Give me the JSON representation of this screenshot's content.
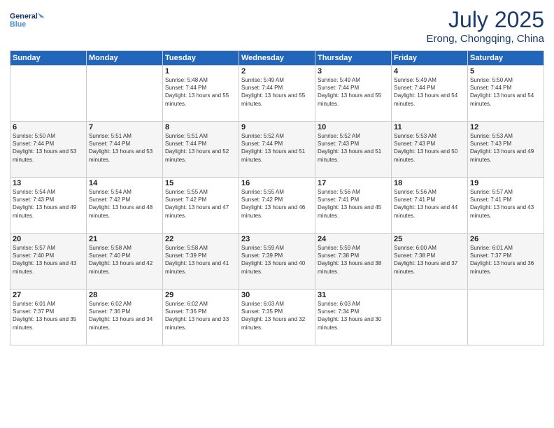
{
  "header": {
    "logo_line1": "General",
    "logo_line2": "Blue",
    "title": "July 2025",
    "subtitle": "Erong, Chongqing, China"
  },
  "weekdays": [
    "Sunday",
    "Monday",
    "Tuesday",
    "Wednesday",
    "Thursday",
    "Friday",
    "Saturday"
  ],
  "weeks": [
    [
      {
        "day": "",
        "sunrise": "",
        "sunset": "",
        "daylight": ""
      },
      {
        "day": "",
        "sunrise": "",
        "sunset": "",
        "daylight": ""
      },
      {
        "day": "1",
        "sunrise": "Sunrise: 5:48 AM",
        "sunset": "Sunset: 7:44 PM",
        "daylight": "Daylight: 13 hours and 55 minutes."
      },
      {
        "day": "2",
        "sunrise": "Sunrise: 5:49 AM",
        "sunset": "Sunset: 7:44 PM",
        "daylight": "Daylight: 13 hours and 55 minutes."
      },
      {
        "day": "3",
        "sunrise": "Sunrise: 5:49 AM",
        "sunset": "Sunset: 7:44 PM",
        "daylight": "Daylight: 13 hours and 55 minutes."
      },
      {
        "day": "4",
        "sunrise": "Sunrise: 5:49 AM",
        "sunset": "Sunset: 7:44 PM",
        "daylight": "Daylight: 13 hours and 54 minutes."
      },
      {
        "day": "5",
        "sunrise": "Sunrise: 5:50 AM",
        "sunset": "Sunset: 7:44 PM",
        "daylight": "Daylight: 13 hours and 54 minutes."
      }
    ],
    [
      {
        "day": "6",
        "sunrise": "Sunrise: 5:50 AM",
        "sunset": "Sunset: 7:44 PM",
        "daylight": "Daylight: 13 hours and 53 minutes."
      },
      {
        "day": "7",
        "sunrise": "Sunrise: 5:51 AM",
        "sunset": "Sunset: 7:44 PM",
        "daylight": "Daylight: 13 hours and 53 minutes."
      },
      {
        "day": "8",
        "sunrise": "Sunrise: 5:51 AM",
        "sunset": "Sunset: 7:44 PM",
        "daylight": "Daylight: 13 hours and 52 minutes."
      },
      {
        "day": "9",
        "sunrise": "Sunrise: 5:52 AM",
        "sunset": "Sunset: 7:44 PM",
        "daylight": "Daylight: 13 hours and 51 minutes."
      },
      {
        "day": "10",
        "sunrise": "Sunrise: 5:52 AM",
        "sunset": "Sunset: 7:43 PM",
        "daylight": "Daylight: 13 hours and 51 minutes."
      },
      {
        "day": "11",
        "sunrise": "Sunrise: 5:53 AM",
        "sunset": "Sunset: 7:43 PM",
        "daylight": "Daylight: 13 hours and 50 minutes."
      },
      {
        "day": "12",
        "sunrise": "Sunrise: 5:53 AM",
        "sunset": "Sunset: 7:43 PM",
        "daylight": "Daylight: 13 hours and 49 minutes."
      }
    ],
    [
      {
        "day": "13",
        "sunrise": "Sunrise: 5:54 AM",
        "sunset": "Sunset: 7:43 PM",
        "daylight": "Daylight: 13 hours and 49 minutes."
      },
      {
        "day": "14",
        "sunrise": "Sunrise: 5:54 AM",
        "sunset": "Sunset: 7:42 PM",
        "daylight": "Daylight: 13 hours and 48 minutes."
      },
      {
        "day": "15",
        "sunrise": "Sunrise: 5:55 AM",
        "sunset": "Sunset: 7:42 PM",
        "daylight": "Daylight: 13 hours and 47 minutes."
      },
      {
        "day": "16",
        "sunrise": "Sunrise: 5:55 AM",
        "sunset": "Sunset: 7:42 PM",
        "daylight": "Daylight: 13 hours and 46 minutes."
      },
      {
        "day": "17",
        "sunrise": "Sunrise: 5:56 AM",
        "sunset": "Sunset: 7:41 PM",
        "daylight": "Daylight: 13 hours and 45 minutes."
      },
      {
        "day": "18",
        "sunrise": "Sunrise: 5:56 AM",
        "sunset": "Sunset: 7:41 PM",
        "daylight": "Daylight: 13 hours and 44 minutes."
      },
      {
        "day": "19",
        "sunrise": "Sunrise: 5:57 AM",
        "sunset": "Sunset: 7:41 PM",
        "daylight": "Daylight: 13 hours and 43 minutes."
      }
    ],
    [
      {
        "day": "20",
        "sunrise": "Sunrise: 5:57 AM",
        "sunset": "Sunset: 7:40 PM",
        "daylight": "Daylight: 13 hours and 43 minutes."
      },
      {
        "day": "21",
        "sunrise": "Sunrise: 5:58 AM",
        "sunset": "Sunset: 7:40 PM",
        "daylight": "Daylight: 13 hours and 42 minutes."
      },
      {
        "day": "22",
        "sunrise": "Sunrise: 5:58 AM",
        "sunset": "Sunset: 7:39 PM",
        "daylight": "Daylight: 13 hours and 41 minutes."
      },
      {
        "day": "23",
        "sunrise": "Sunrise: 5:59 AM",
        "sunset": "Sunset: 7:39 PM",
        "daylight": "Daylight: 13 hours and 40 minutes."
      },
      {
        "day": "24",
        "sunrise": "Sunrise: 5:59 AM",
        "sunset": "Sunset: 7:38 PM",
        "daylight": "Daylight: 13 hours and 38 minutes."
      },
      {
        "day": "25",
        "sunrise": "Sunrise: 6:00 AM",
        "sunset": "Sunset: 7:38 PM",
        "daylight": "Daylight: 13 hours and 37 minutes."
      },
      {
        "day": "26",
        "sunrise": "Sunrise: 6:01 AM",
        "sunset": "Sunset: 7:37 PM",
        "daylight": "Daylight: 13 hours and 36 minutes."
      }
    ],
    [
      {
        "day": "27",
        "sunrise": "Sunrise: 6:01 AM",
        "sunset": "Sunset: 7:37 PM",
        "daylight": "Daylight: 13 hours and 35 minutes."
      },
      {
        "day": "28",
        "sunrise": "Sunrise: 6:02 AM",
        "sunset": "Sunset: 7:36 PM",
        "daylight": "Daylight: 13 hours and 34 minutes."
      },
      {
        "day": "29",
        "sunrise": "Sunrise: 6:02 AM",
        "sunset": "Sunset: 7:36 PM",
        "daylight": "Daylight: 13 hours and 33 minutes."
      },
      {
        "day": "30",
        "sunrise": "Sunrise: 6:03 AM",
        "sunset": "Sunset: 7:35 PM",
        "daylight": "Daylight: 13 hours and 32 minutes."
      },
      {
        "day": "31",
        "sunrise": "Sunrise: 6:03 AM",
        "sunset": "Sunset: 7:34 PM",
        "daylight": "Daylight: 13 hours and 30 minutes."
      },
      {
        "day": "",
        "sunrise": "",
        "sunset": "",
        "daylight": ""
      },
      {
        "day": "",
        "sunrise": "",
        "sunset": "",
        "daylight": ""
      }
    ]
  ]
}
